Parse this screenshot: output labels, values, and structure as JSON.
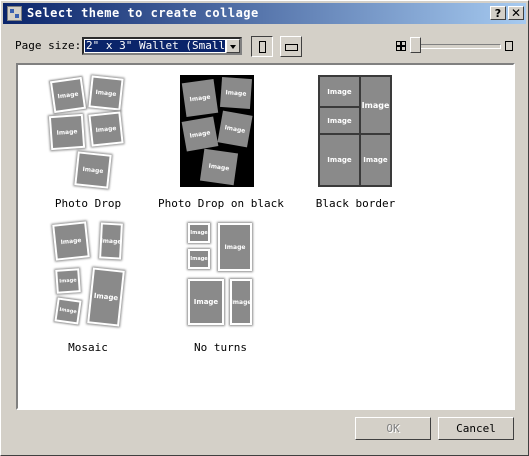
{
  "window": {
    "title": "Select theme to create collage"
  },
  "toolbar": {
    "page_size_label": "Page size:",
    "page_size_value": "2\" x 3\" Wallet (Small)"
  },
  "themes": [
    {
      "label": "Photo Drop"
    },
    {
      "label": "Photo Drop on black"
    },
    {
      "label": "Black border"
    },
    {
      "label": "Mosaic"
    },
    {
      "label": "No turns"
    }
  ],
  "photo_text": "Image",
  "buttons": {
    "ok": "OK",
    "cancel": "Cancel"
  }
}
